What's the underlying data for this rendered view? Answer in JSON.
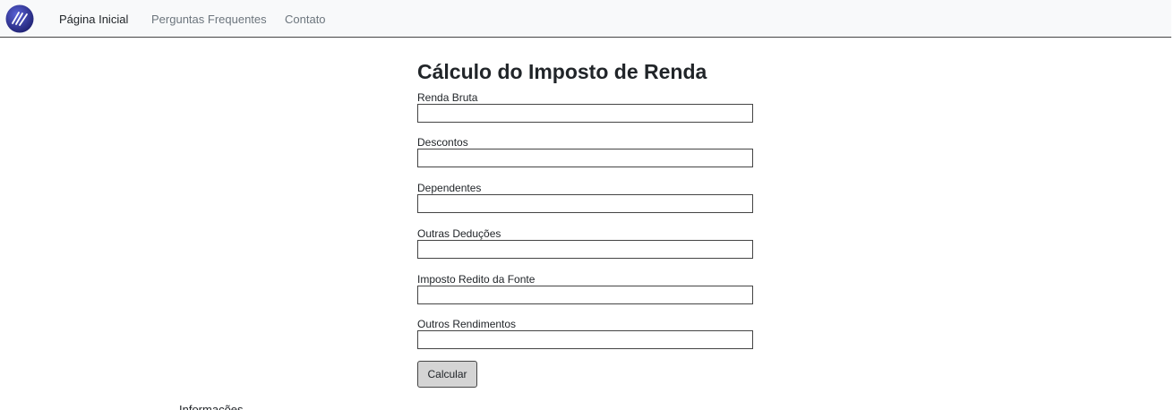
{
  "navbar": {
    "brand_icon": "slashes-logo-icon",
    "brand_color": "#2b2f8f",
    "links": [
      {
        "label": "Página Inicial",
        "active": true
      },
      {
        "label": "Perguntas Frequentes",
        "active": false
      },
      {
        "label": "Contato",
        "active": false
      }
    ]
  },
  "form": {
    "title": "Cálculo do Imposto de Renda",
    "fields": [
      {
        "label": "Renda Bruta",
        "value": ""
      },
      {
        "label": "Descontos",
        "value": ""
      },
      {
        "label": "Dependentes",
        "value": ""
      },
      {
        "label": "Outras Deduções",
        "value": ""
      },
      {
        "label": "Imposto Redito da Fonte",
        "value": ""
      },
      {
        "label": "Outros Rendimentos",
        "value": ""
      }
    ],
    "submit_label": "Calcular"
  },
  "footer": {
    "partial_text": "Informações"
  }
}
